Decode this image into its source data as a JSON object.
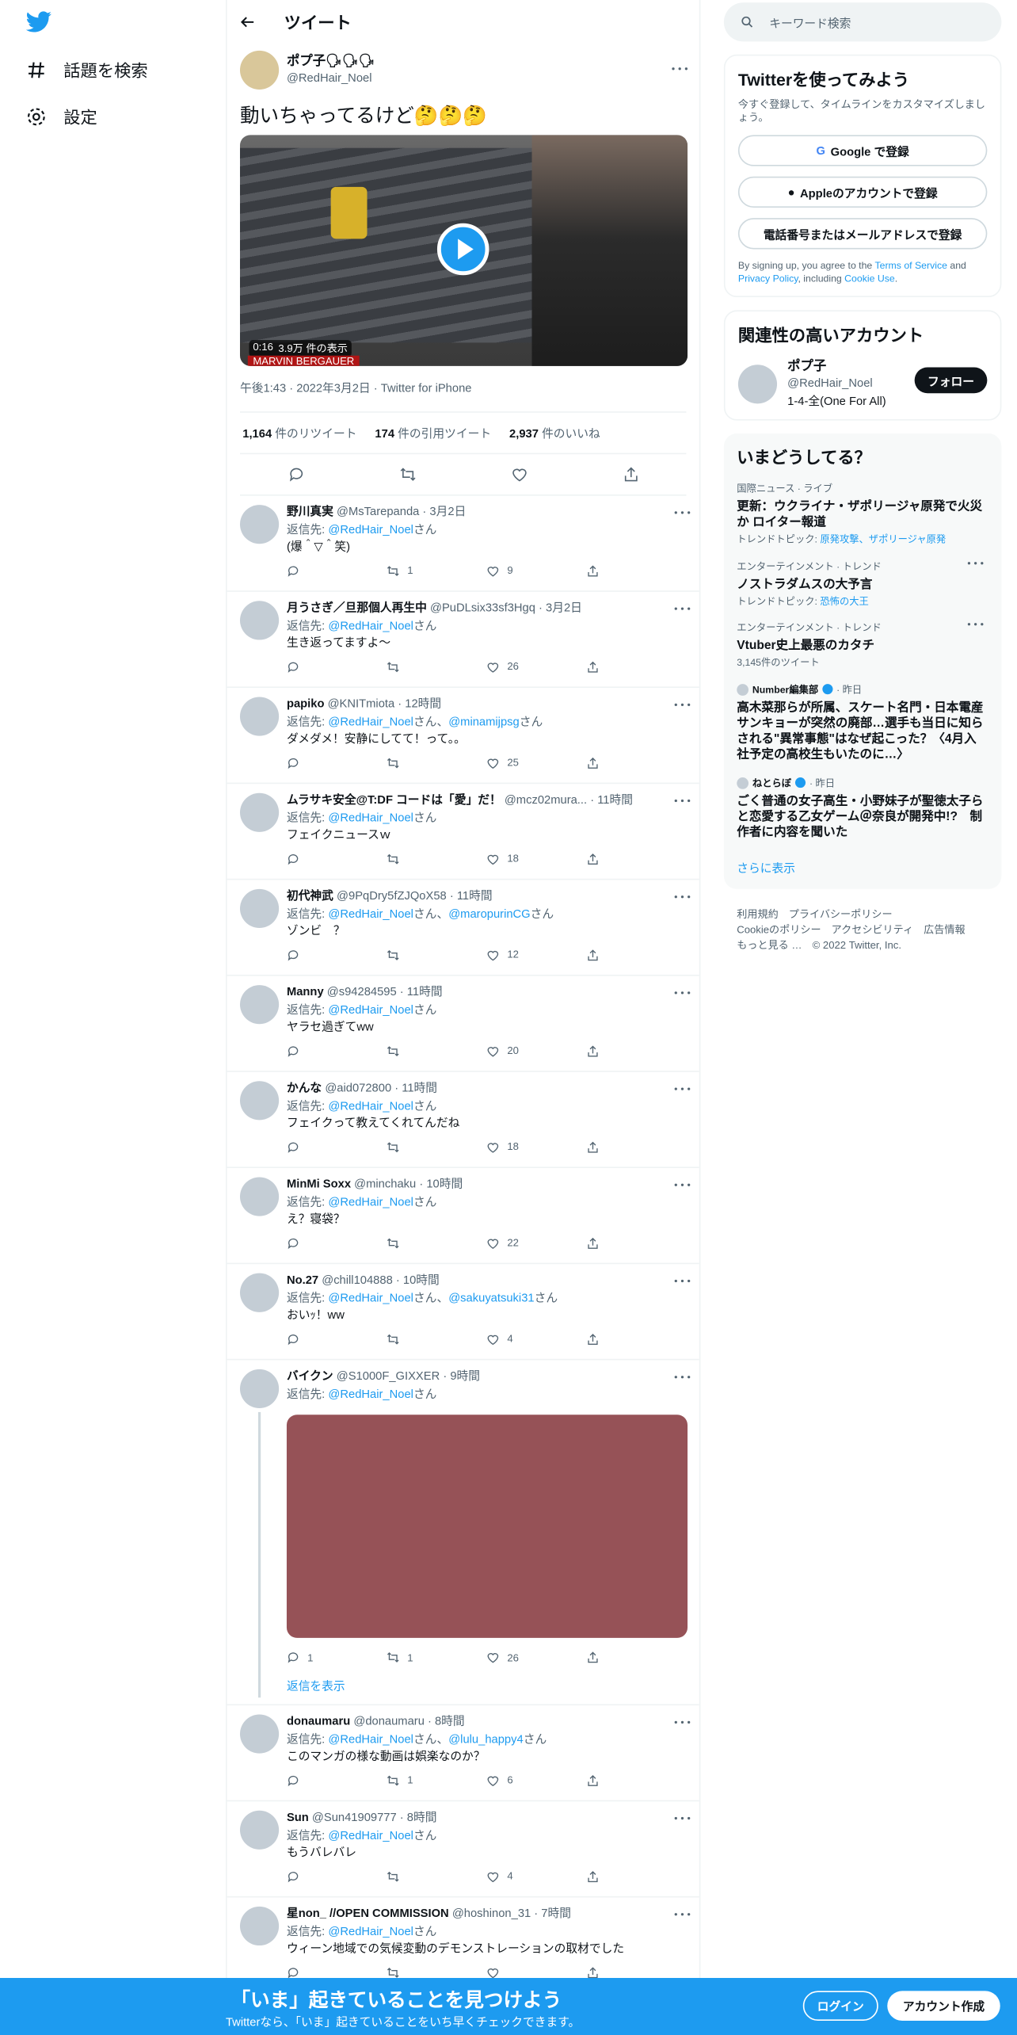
{
  "nav": {
    "search": "話題を検索",
    "settings": "設定"
  },
  "header": {
    "title": "ツイート"
  },
  "tweet": {
    "name": "ポプ子🗣🗣🗣",
    "handle": "@RedHair_Noel",
    "text": "動いちゃってるけど🤔🤔🤔",
    "duration": "0:16",
    "views": "3.9万 件の表示",
    "caption": "MARVIN BERGAUER",
    "meta": "午後1:43 · 2022年3月2日 · Twitter for iPhone",
    "retweets": "1,164",
    "retweets_label": "件のリツイート",
    "quotes": "174",
    "quotes_label": "件の引用ツイート",
    "likes": "2,937",
    "likes_label": "件のいいね"
  },
  "replies": [
    {
      "name": "野川真実",
      "handle": "@MsTarepanda · 3月2日",
      "to": "@RedHair_Noel",
      "to2": "",
      "text": "(爆＾▽＾笑)",
      "rt": "1",
      "like": "9",
      "reply": ""
    },
    {
      "name": "月うさぎ／旦那個人再生中",
      "handle": "@PuDLsix33sf3Hgq · 3月2日",
      "to": "@RedHair_Noel",
      "to2": "",
      "text": "生き返ってますよ〜",
      "rt": "",
      "like": "26",
      "reply": ""
    },
    {
      "name": "papiko",
      "handle": "@KNITmiota · 12時間",
      "to": "@RedHair_Noel",
      "to2": "@minamijpsg",
      "text": "ダメダメ！安静にしてて！って。。",
      "rt": "",
      "like": "25",
      "reply": ""
    },
    {
      "name": "ムラサキ安全@T:DF コードは「愛」だ！",
      "handle": "@mcz02mura... · 11時間",
      "to": "@RedHair_Noel",
      "to2": "",
      "text": "フェイクニュースｗ",
      "rt": "",
      "like": "18",
      "reply": ""
    },
    {
      "name": "初代神武",
      "handle": "@9PqDry5fZJQoX58 · 11時間",
      "to": "@RedHair_Noel",
      "to2": "@maropurinCG",
      "text": "ゾンビ　？",
      "rt": "",
      "like": "12",
      "reply": ""
    },
    {
      "name": "Manny",
      "handle": "@s94284595 · 11時間",
      "to": "@RedHair_Noel",
      "to2": "",
      "text": "ヤラセ過ぎてww",
      "rt": "",
      "like": "20",
      "reply": ""
    },
    {
      "name": "かんな",
      "handle": "@aid072800 · 11時間",
      "to": "@RedHair_Noel",
      "to2": "",
      "text": "フェイクって教えてくれてんだね",
      "rt": "",
      "like": "18",
      "reply": ""
    },
    {
      "name": "MinMi Soxx",
      "handle": "@minchaku · 10時間",
      "to": "@RedHair_Noel",
      "to2": "",
      "text": "え？寝袋？",
      "rt": "",
      "like": "22",
      "reply": ""
    },
    {
      "name": "No.27",
      "handle": "@chill104888 · 10時間",
      "to": "@RedHair_Noel",
      "to2": "@sakuyatsuki31",
      "text": "おいｯ！ww",
      "rt": "",
      "like": "4",
      "reply": ""
    }
  ],
  "thread_reply": {
    "name": "バイクン",
    "handle": "@S1000F_GIXXER · 9時間",
    "to": "@RedHair_Noel",
    "reply": "1",
    "rt": "1",
    "like": "26",
    "show": "返信を表示"
  },
  "replies2": [
    {
      "name": "donaumaru",
      "handle": "@donaumaru · 8時間",
      "to": "@RedHair_Noel",
      "to2": "@lulu_happy4",
      "text": "このマンガの様な動画は娯楽なのか？",
      "rt": "1",
      "like": "6",
      "reply": ""
    },
    {
      "name": "Sun",
      "handle": "@Sun41909777 · 8時間",
      "to": "@RedHair_Noel",
      "to2": "",
      "text": "もうバレバレ",
      "rt": "",
      "like": "4",
      "reply": ""
    },
    {
      "name": "星non_ //OPEN COMMISSION",
      "handle": "@hoshinon_31 · 7時間",
      "to": "@RedHair_Noel",
      "to2": "",
      "text": "ウィーン地域での気候変動のデモンストレーションの取材でした",
      "rt": "",
      "like": "",
      "reply": ""
    }
  ],
  "labels": {
    "reply_to": "返信先: ",
    "san": "さん",
    "and": "、"
  },
  "right": {
    "search_placeholder": "キーワード検索",
    "signup_title": "Twitterを使ってみよう",
    "signup_sub": "今すぐ登録して、タイムラインをカスタマイズしましょう。",
    "google": "Google で登録",
    "apple": "Appleのアカウントで登録",
    "phone": "電話番号またはメールアドレスで登録",
    "fine1": "By signing up, you agree to the ",
    "fine_tos": "Terms of Service",
    "fine2": " and ",
    "fine_pp": "Privacy Policy",
    "fine3": ", including ",
    "fine_cookie": "Cookie Use",
    "fine4": ".",
    "related_title": "関連性の高いアカウント",
    "related_name": "ポプ子",
    "related_handle": "@RedHair_Noel",
    "related_bio": "1-4-全(One For All)",
    "follow": "フォロー",
    "trends_title": "いまどうしてる？",
    "t1_cat": "国際ニュース · ライブ",
    "t1_title": "更新：ウクライナ・ザポリージャ原発で火災か ロイター報道",
    "t1_topic_label": "トレンドトピック: ",
    "t1_topic": "原発攻撃、ザポリージャ原発",
    "t2_cat": "エンターテインメント · トレンド",
    "t2_title": "ノストラダムスの大予言",
    "t2_topic_label": "トレンドトピック: ",
    "t2_topic": "恐怖の大王",
    "t3_cat": "エンターテインメント · トレンド",
    "t3_title": "Vtuber史上最悪のカタチ",
    "t3_count": "3,145件のツイート",
    "t4_src": "Number編集部",
    "t4_time": " · 昨日",
    "t4_title": "高木菜那らが所属、スケート名門・日本電産サンキョーが突然の廃部…選手も当日に知らされる\"異常事態\"はなぜ起こった？〈4月入社予定の高校生もいたのに…〉",
    "t5_src": "ねとらぼ",
    "t5_time": " · 昨日",
    "t5_title": "ごく普通の女子高生・小野妹子が聖徳太子らと恋愛する乙女ゲーム＠奈良が開発中!?　制作者に内容を聞いた",
    "more": "さらに表示",
    "footer1": "利用規約　プライバシーポリシー",
    "footer2": "Cookieのポリシー　アクセシビリティ　広告情報",
    "footer3": "もっと見る …　© 2022 Twitter, Inc."
  },
  "bottom": {
    "title": "「いま」起きていることを見つけよう",
    "sub": "Twitterなら、「いま」起きていることをいち早くチェックできます。",
    "login": "ログイン",
    "signup": "アカウント作成"
  },
  "colors": {
    "accent": "#1d9bf0",
    "image_placeholder": "#965257"
  }
}
